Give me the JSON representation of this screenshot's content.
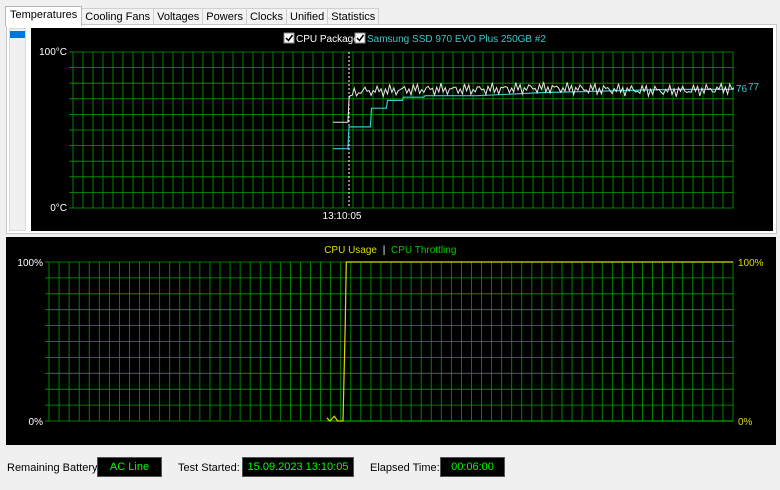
{
  "tabs": [
    "Temperatures",
    "Cooling Fans",
    "Voltages",
    "Powers",
    "Clocks",
    "Unified",
    "Statistics"
  ],
  "colors": {
    "grid": "#00a000",
    "cpu_package": "#e8e8e8",
    "ssd": "#33cccc",
    "cpu_usage": "#dddd00",
    "throttling": "#00cc00"
  },
  "temp_panel": {
    "y_top_label": "100°C",
    "y_bottom_label": "0°C",
    "time_label": "13:10:05",
    "legend": [
      {
        "label": "CPU Package",
        "checked": true,
        "color": "#ffffff"
      },
      {
        "label": "Samsung SSD 970 EVO Plus 250GB #2",
        "checked": true,
        "color": "#33cccc"
      }
    ],
    "end_label_ssd": "76",
    "end_label_cpu": "77"
  },
  "usage_panel": {
    "legend_usage": "CPU Usage",
    "legend_sep": "|",
    "legend_throttling": "CPU Throttling",
    "left_top_label": "100%",
    "left_bottom_label": "0%",
    "right_top_label": "100%",
    "right_bottom_label": "0%"
  },
  "status": {
    "battery_label": "Remaining Battery:",
    "battery_value": "AC Line",
    "test_started_label": "Test Started:",
    "test_started_value": "15.09.2023 13:10:05",
    "elapsed_label": "Elapsed Time:",
    "elapsed_value": "00:06:00"
  },
  "chart_data": [
    {
      "type": "line",
      "title": "",
      "ylabel": "",
      "ylim": [
        0,
        100
      ],
      "x_tick_labels": [
        "13:10:05"
      ],
      "grid": true,
      "legend_placement": "top-center",
      "series": [
        {
          "name": "CPU Package",
          "x_seconds": [
            -15,
            -1,
            0,
            1,
            5,
            15,
            30,
            60,
            120,
            180,
            240,
            300,
            340,
            360
          ],
          "values": [
            55,
            55,
            70,
            72,
            74,
            75,
            75,
            76,
            76,
            77,
            76,
            75,
            76,
            77
          ]
        },
        {
          "name": "Samsung SSD 970 EVO Plus 250GB #2",
          "x_seconds": [
            -15,
            -1,
            0,
            20,
            21,
            35,
            36,
            50,
            51,
            70,
            71,
            120,
            180,
            240,
            300,
            360
          ],
          "values": [
            38,
            38,
            52,
            52,
            64,
            64,
            69,
            69,
            71,
            71,
            72,
            72,
            74,
            75,
            76,
            76
          ]
        }
      ]
    },
    {
      "type": "line",
      "title": "",
      "ylim": [
        0,
        100
      ],
      "legend_placement": "top-center",
      "series": [
        {
          "name": "CPU Usage",
          "x_seconds": [
            -15,
            -12,
            -8,
            -5,
            -2,
            0,
            2,
            3,
            360
          ],
          "values": [
            2,
            0,
            3,
            0,
            0,
            0,
            60,
            100,
            100
          ]
        },
        {
          "name": "CPU Throttling",
          "x_seconds": [
            -15,
            360
          ],
          "values": [
            0,
            0
          ]
        }
      ]
    }
  ]
}
